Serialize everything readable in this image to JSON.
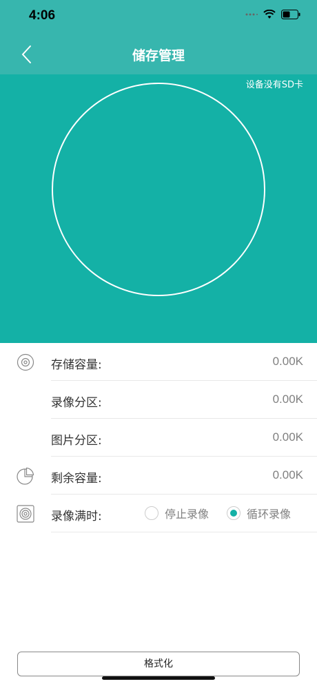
{
  "status_bar": {
    "time": "4:06",
    "icons": [
      "signal-dots-icon",
      "wifi-icon",
      "battery-icon"
    ]
  },
  "nav": {
    "title": "储存管理",
    "back_icon": "chevron-left-icon"
  },
  "hero": {
    "sd_status": "设备没有SD卡"
  },
  "storage": {
    "rows": [
      {
        "label": "存储容量:",
        "value": "0.00K",
        "icon": "disc-icon"
      },
      {
        "label": "录像分区:",
        "value": "0.00K"
      },
      {
        "label": "图片分区:",
        "value": "0.00K"
      },
      {
        "label": "剩余容量:",
        "value": "0.00K",
        "icon": "pie-chart-icon"
      }
    ],
    "record_full": {
      "label": "录像满时:",
      "icon": "speaker-box-icon",
      "options": [
        {
          "label": "停止录像",
          "checked": false
        },
        {
          "label": "循环录像",
          "checked": true
        }
      ]
    }
  },
  "actions": {
    "format_label": "格式化"
  },
  "colors": {
    "accent": "#14b1a6",
    "nav": "#37b6ae"
  }
}
